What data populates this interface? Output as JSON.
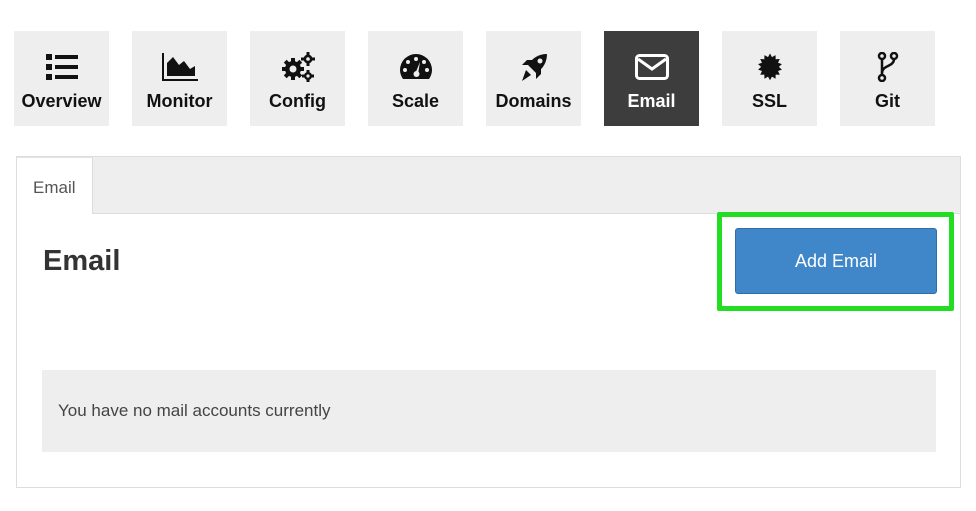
{
  "nav": {
    "items": [
      {
        "label": "Overview",
        "icon": "list-icon",
        "active": false
      },
      {
        "label": "Monitor",
        "icon": "area-chart-icon",
        "active": false
      },
      {
        "label": "Config",
        "icon": "gears-icon",
        "active": false
      },
      {
        "label": "Scale",
        "icon": "dashboard-icon",
        "active": false
      },
      {
        "label": "Domains",
        "icon": "rocket-icon",
        "active": false
      },
      {
        "label": "Email",
        "icon": "envelope-icon",
        "active": true
      },
      {
        "label": "SSL",
        "icon": "certificate-icon",
        "active": false
      },
      {
        "label": "Git",
        "icon": "git-branch-icon",
        "active": false
      }
    ]
  },
  "panel": {
    "tab_label": "Email",
    "heading": "Email",
    "add_button_label": "Add Email",
    "empty_message": "You have no mail accounts currently"
  },
  "colors": {
    "active_tile": "#3d3d3d",
    "tile": "#eeeeee",
    "primary_button": "#3f87c9",
    "highlight_outline": "#22dd22"
  }
}
